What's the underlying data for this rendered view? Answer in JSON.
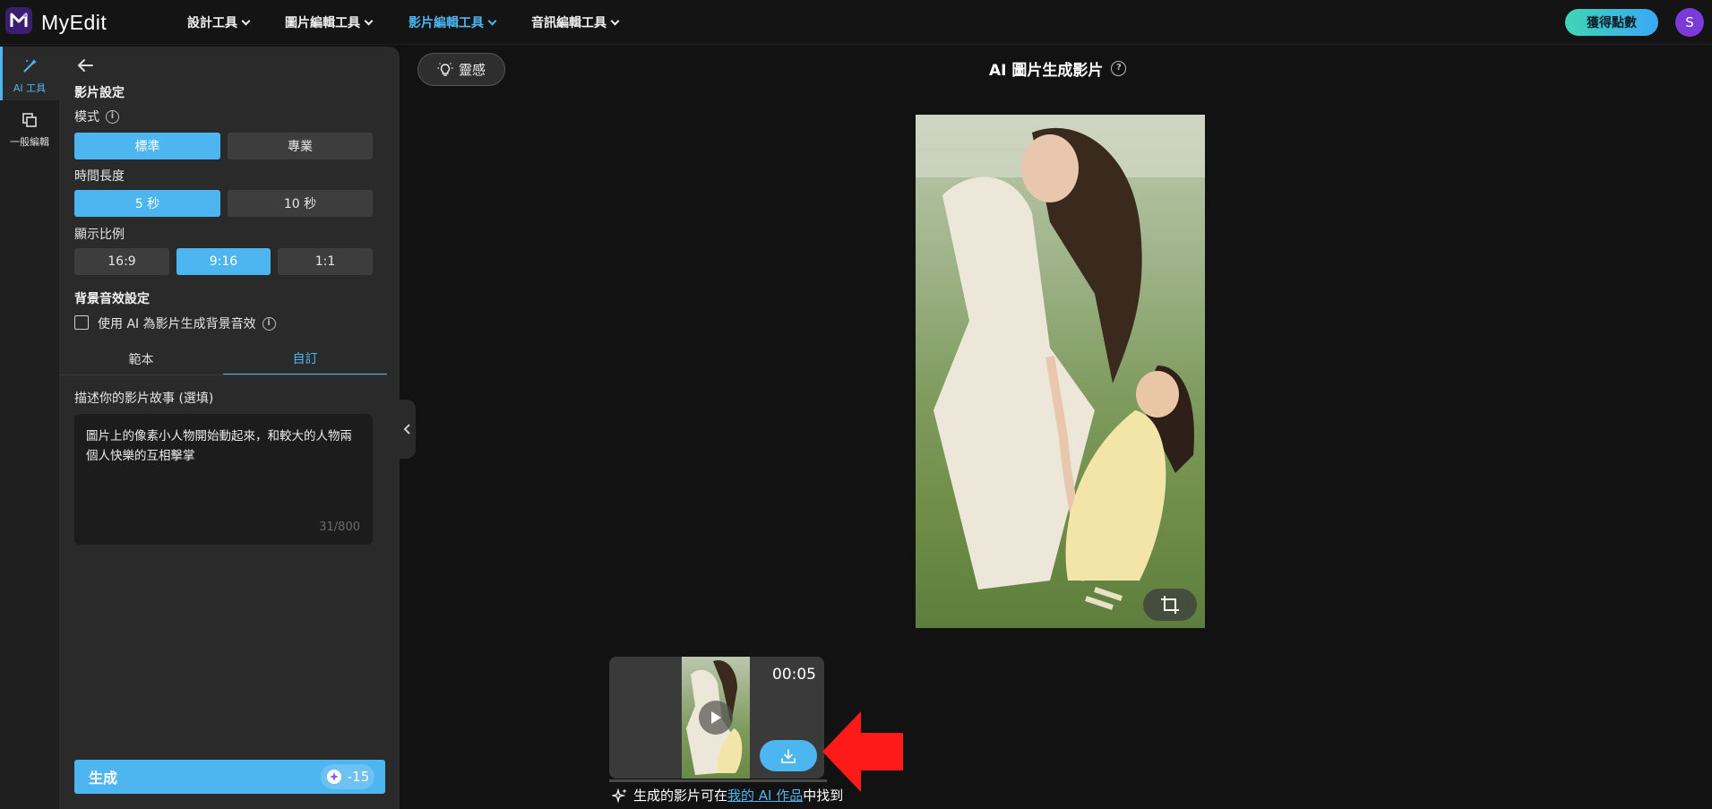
{
  "app": {
    "logo_text": "MyEdit",
    "brand_color": "#4db5ef"
  },
  "nav": {
    "items": [
      {
        "label": "設計工具"
      },
      {
        "label": "圖片編輯工具"
      },
      {
        "label": "影片編輯工具",
        "active": true
      },
      {
        "label": "音訊編輯工具"
      }
    ],
    "points_button": "獲得點數",
    "avatar_initial": "S"
  },
  "rail": {
    "items": [
      {
        "label": "AI 工具",
        "icon": "magic-wand-icon",
        "active": true
      },
      {
        "label": "一般編輯",
        "icon": "layers-icon"
      }
    ]
  },
  "panel": {
    "video_settings": "影片設定",
    "mode": {
      "label": "模式",
      "options": [
        "標準",
        "專業"
      ],
      "selected": "標準"
    },
    "duration": {
      "label": "時間長度",
      "options": [
        "5 秒",
        "10 秒"
      ],
      "selected": "5 秒"
    },
    "ratio": {
      "label": "顯示比例",
      "options": [
        "16:9",
        "9:16",
        "1:1"
      ],
      "selected": "9:16"
    },
    "bgm": {
      "label": "背景音效設定",
      "checkbox_label": "使用 AI 為影片生成背景音效",
      "checked": false
    },
    "tabs": [
      "範本",
      "自訂"
    ],
    "active_tab": "自訂",
    "story": {
      "label": "描述你的影片故事 (選填)",
      "value": "圖片上的像素小人物開始動起來，和較大的人物兩個人快樂的互相擊掌",
      "counter": "31/800"
    },
    "generate": {
      "label": "生成",
      "cost": "-15"
    }
  },
  "canvas": {
    "inspiration_button": "靈感",
    "title": "AI 圖片生成影片",
    "result": {
      "duration": "00:05"
    },
    "hint": {
      "prefix": "生成的影片可在",
      "link": "我的 AI 作品",
      "suffix": "中找到"
    }
  }
}
